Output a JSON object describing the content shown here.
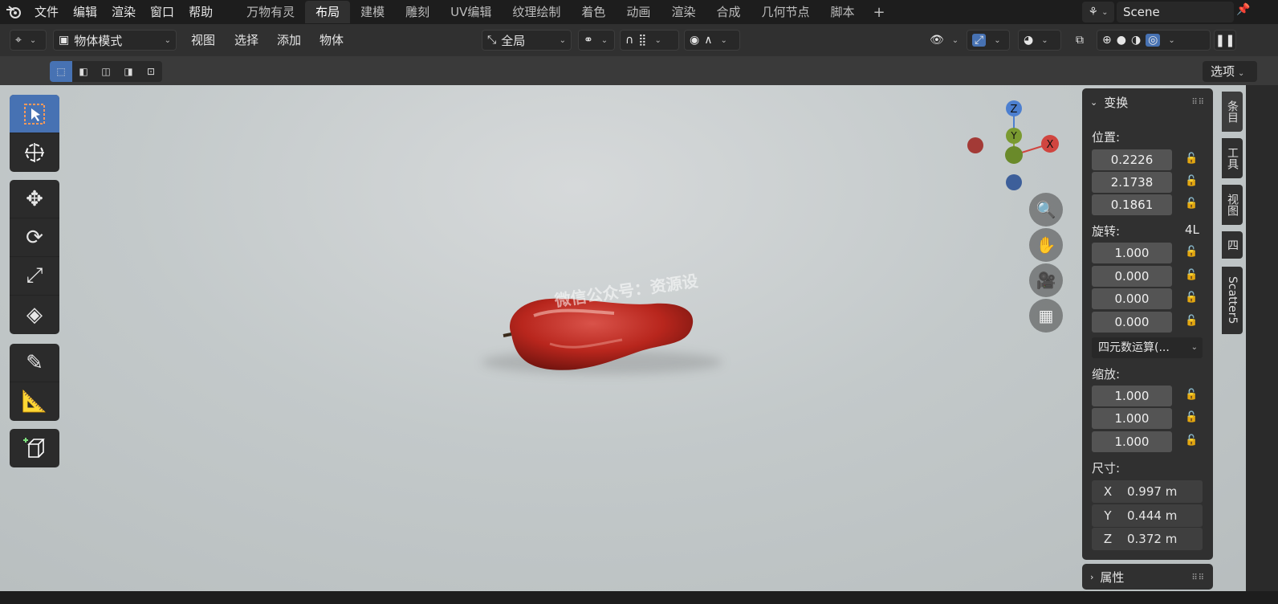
{
  "menu": {
    "logo": "blender-logo",
    "items": [
      "文件",
      "编辑",
      "渲染",
      "窗口",
      "帮助"
    ]
  },
  "workspaces": {
    "tabs": [
      "万物有灵",
      "布局",
      "建模",
      "雕刻",
      "UV编辑",
      "纹理绘制",
      "着色",
      "动画",
      "渲染",
      "合成",
      "几何节点",
      "脚本"
    ],
    "active_index": 1,
    "add_label": "+"
  },
  "scene": {
    "name": "Scene"
  },
  "header": {
    "mode": "物体模式",
    "menus": [
      "视图",
      "选择",
      "添加",
      "物体"
    ],
    "orientation": "全局"
  },
  "subbar": {
    "options_label": "选项"
  },
  "viewport": {
    "watermark": "微信公众号：资源设"
  },
  "gizmo": {
    "z": "Z",
    "y": "Y",
    "x": "X"
  },
  "npanel": {
    "transform_title": "变换",
    "location_label": "位置:",
    "location": [
      "0.2226",
      "2.1738",
      "0.1861"
    ],
    "rotation_label": "旋转:",
    "rotation_mode_badge": "4L",
    "rotation": [
      "1.000",
      "0.000",
      "0.000",
      "0.000"
    ],
    "rotation_mode": "四元数运算(...",
    "scale_label": "缩放:",
    "scale": [
      "1.000",
      "1.000",
      "1.000"
    ],
    "dimensions_label": "尺寸:",
    "dimensions": [
      {
        "axis": "X",
        "value": "0.997 m"
      },
      {
        "axis": "Y",
        "value": "0.444 m"
      },
      {
        "axis": "Z",
        "value": "0.372 m"
      }
    ],
    "properties_title": "属性"
  },
  "side_tabs": [
    "条目",
    "工具",
    "视图",
    "四",
    "Scatter5"
  ]
}
